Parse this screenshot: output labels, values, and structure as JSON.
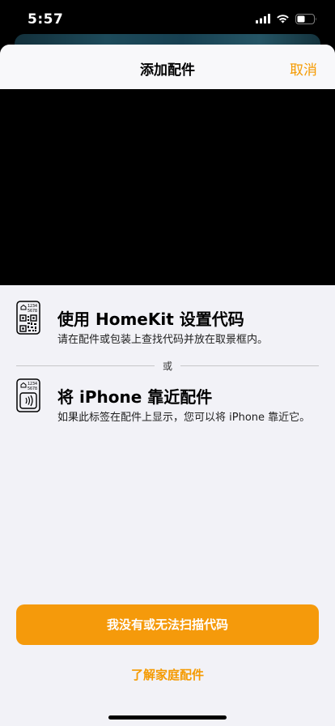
{
  "status_bar": {
    "time": "5:57"
  },
  "nav": {
    "title": "添加配件",
    "cancel_label": "取消"
  },
  "options": [
    {
      "title": "使用 HomeKit 设置代码",
      "subtitle": "请在配件或包装上查找代码并放在取景框内。",
      "icon_code_top": "1234",
      "icon_code_bottom": "5678"
    },
    {
      "title": "将 iPhone 靠近配件",
      "subtitle": "如果此标签在配件上显示，您可以将 iPhone 靠近它。",
      "icon_code_top": "1234",
      "icon_code_bottom": "5678"
    }
  ],
  "divider_label": "或",
  "primary_button_label": "我没有或无法扫描代码",
  "learn_more_label": "了解家庭配件",
  "colors": {
    "accent": "#f59a00",
    "sheet_bg": "#f2f2f7"
  }
}
